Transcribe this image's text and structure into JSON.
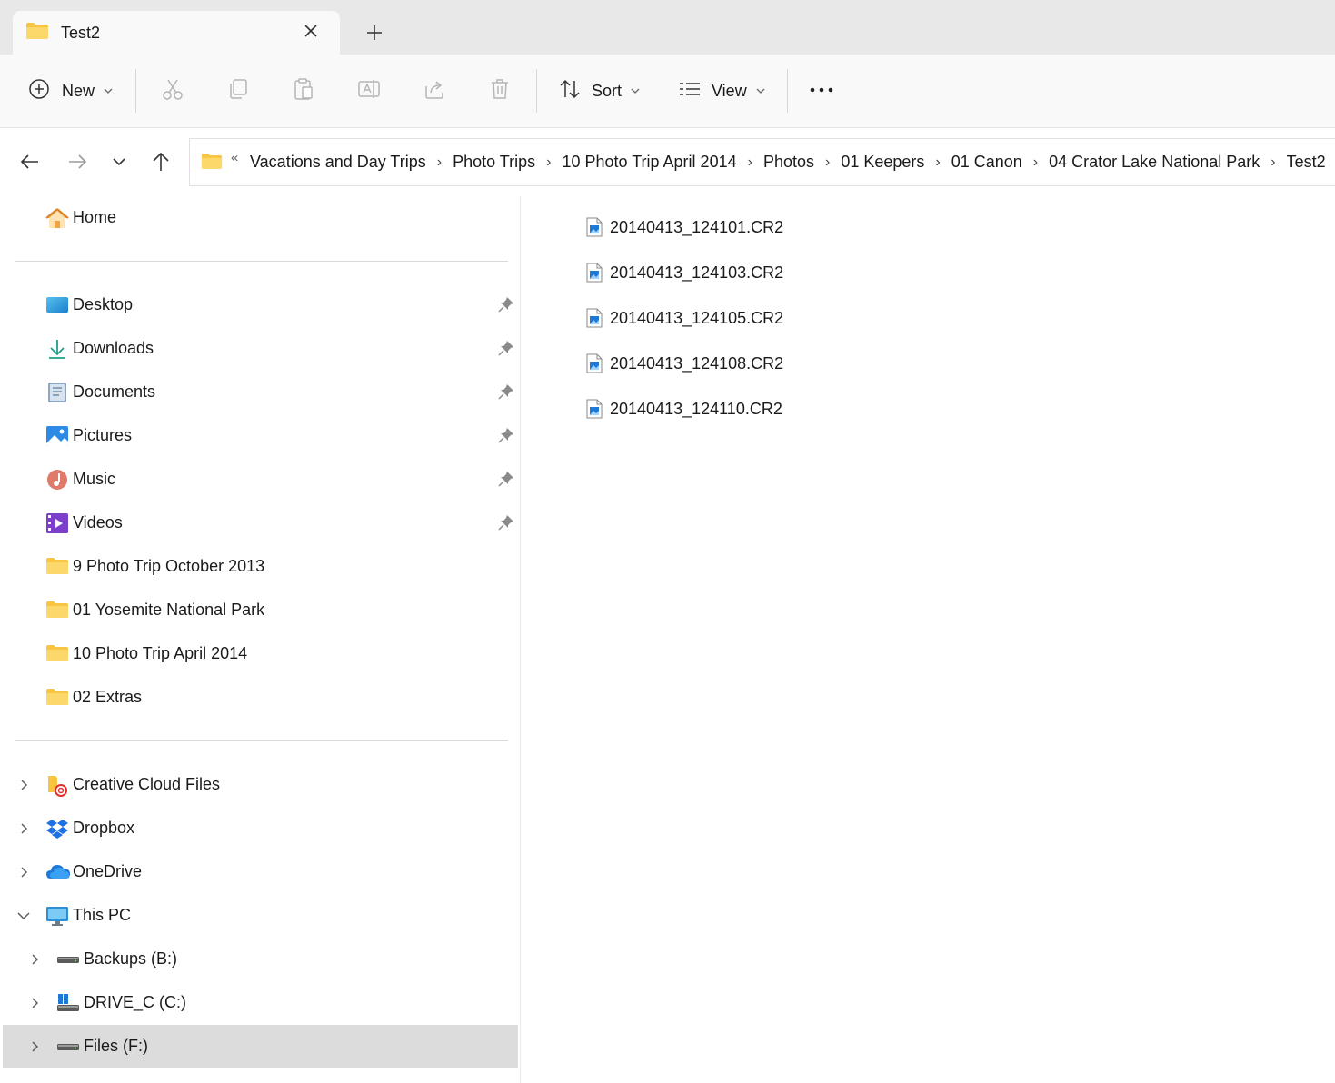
{
  "window": {
    "tab_title": "Test2",
    "tab_icon": "folder-icon",
    "close_icon": "close-icon",
    "new_tab_icon": "plus-icon"
  },
  "toolbar": {
    "new_label": "New",
    "sort_label": "Sort",
    "view_label": "View",
    "icons": [
      "plus-circle-icon",
      "cut-icon",
      "copy-icon",
      "paste-icon",
      "rename-icon",
      "share-icon",
      "delete-icon",
      "sort-icon",
      "view-icon",
      "more-icon"
    ]
  },
  "navigation": {
    "overflow_marker": "«",
    "breadcrumbs": [
      "Vacations and Day Trips",
      "Photo Trips",
      "10 Photo Trip April 2014",
      "Photos",
      "01 Keepers",
      "01 Canon",
      "04 Crator Lake National Park",
      "Test2"
    ]
  },
  "sidebar": {
    "home": {
      "label": "Home",
      "icon": "home-icon"
    },
    "quick_access": [
      {
        "label": "Desktop",
        "icon": "desktop-icon",
        "pinned": true
      },
      {
        "label": "Downloads",
        "icon": "download-icon",
        "pinned": true
      },
      {
        "label": "Documents",
        "icon": "documents-icon",
        "pinned": true
      },
      {
        "label": "Pictures",
        "icon": "pictures-icon",
        "pinned": true
      },
      {
        "label": "Music",
        "icon": "music-icon",
        "pinned": true
      },
      {
        "label": "Videos",
        "icon": "videos-icon",
        "pinned": true
      },
      {
        "label": "9 Photo Trip October 2013",
        "icon": "folder-icon",
        "pinned": false
      },
      {
        "label": "01 Yosemite National Park",
        "icon": "folder-icon",
        "pinned": false
      },
      {
        "label": "10 Photo Trip April 2014",
        "icon": "folder-icon",
        "pinned": false
      },
      {
        "label": "02 Extras",
        "icon": "folder-icon",
        "pinned": false
      }
    ],
    "locations": [
      {
        "label": "Creative Cloud Files",
        "icon": "creative-cloud-icon",
        "expanded": false
      },
      {
        "label": "Dropbox",
        "icon": "dropbox-icon",
        "expanded": false
      },
      {
        "label": "OneDrive",
        "icon": "onedrive-icon",
        "expanded": false
      },
      {
        "label": "This PC",
        "icon": "this-pc-icon",
        "expanded": true
      }
    ],
    "drives": [
      {
        "label": "Backups (B:)",
        "icon": "drive-icon",
        "selected": false
      },
      {
        "label": "DRIVE_C (C:)",
        "icon": "system-drive-icon",
        "selected": false
      },
      {
        "label": "Files (F:)",
        "icon": "drive-icon",
        "selected": true
      }
    ]
  },
  "files": [
    {
      "name": "20140413_124101.CR2",
      "icon": "raw-image-file-icon"
    },
    {
      "name": "20140413_124103.CR2",
      "icon": "raw-image-file-icon"
    },
    {
      "name": "20140413_124105.CR2",
      "icon": "raw-image-file-icon"
    },
    {
      "name": "20140413_124108.CR2",
      "icon": "raw-image-file-icon"
    },
    {
      "name": "20140413_124110.CR2",
      "icon": "raw-image-file-icon"
    }
  ],
  "colors": {
    "folder_yellow": "#F8C542",
    "accent_blue": "#0a63c9",
    "selected_bg": "#dcdcdc"
  }
}
